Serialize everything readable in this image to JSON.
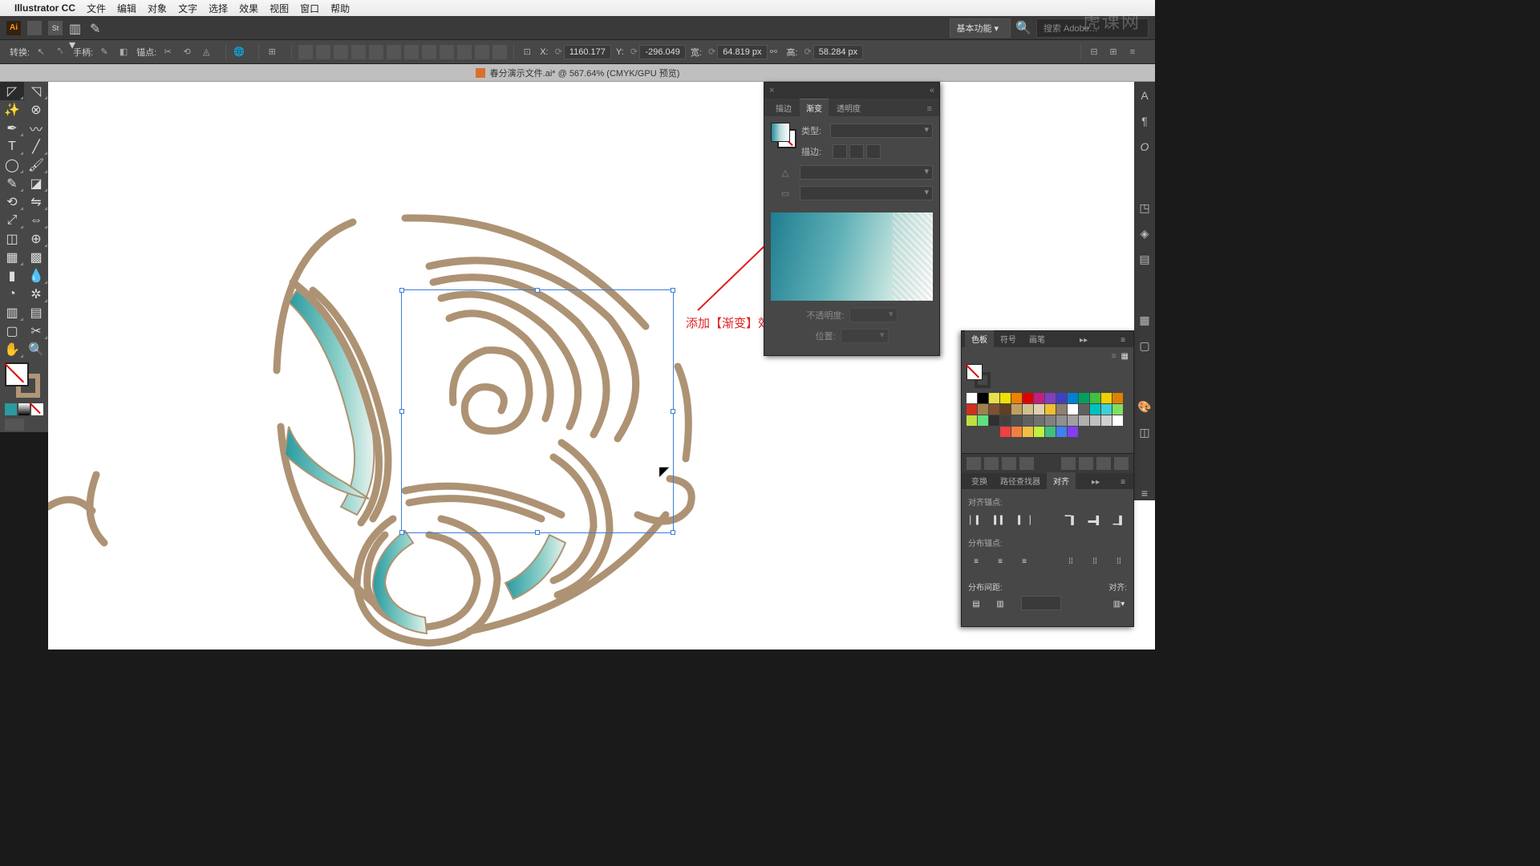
{
  "menubar": {
    "app_name": "Illustrator CC",
    "items": [
      "文件",
      "编辑",
      "对象",
      "文字",
      "选择",
      "效果",
      "视图",
      "窗口",
      "帮助"
    ]
  },
  "toolbar1": {
    "workspace": "基本功能",
    "search_placeholder": "搜索 Adobe…"
  },
  "toolbar2": {
    "transform_label": "转换:",
    "handle_label": "手柄:",
    "anchor_label": "锚点:",
    "x_label": "X:",
    "x_value": "1160.177",
    "y_label": "Y:",
    "y_value": "-296.049",
    "w_label": "宽:",
    "w_value": "64.819 px",
    "h_label": "高:",
    "h_value": "58.284 px"
  },
  "document": {
    "title": "春分演示文件.ai* @ 567.64% (CMYK/GPU 预览)"
  },
  "annot": {
    "text": "添加【渐变】效果"
  },
  "grad_panel": {
    "tab_stroke": "描边",
    "tab_gradient": "渐变",
    "tab_opacity": "透明度",
    "type_label": "类型:",
    "stroke_label": "描边:",
    "opacity_label": "不透明度:",
    "location_label": "位置:"
  },
  "swatch_panel": {
    "tab_swatches": "色板",
    "tab_symbols": "符号",
    "tab_brushes": "画笔",
    "colors_row1": [
      "#ffffff",
      "#000000",
      "#e8e04a",
      "#f0e000",
      "#f08000",
      "#e00000",
      "#c02080",
      "#8040c0",
      "#4040c0",
      "#0080d0",
      "#00a060",
      "#40c040",
      "#f0d000",
      "#e08000",
      "#d03020"
    ],
    "colors_row2": [
      "#a08050",
      "#805030",
      "#604020",
      "#c0a060",
      "#d0c090",
      "#e0d0b0",
      "#f0c030",
      "#908070",
      "#ffffff",
      "#606060",
      "#00c0c0",
      "#40d0d0",
      "#80e060",
      "#c0e040",
      "#60e080"
    ],
    "colors_row3": [
      "#303030",
      "#404040",
      "#505050",
      "#606060",
      "#707070",
      "#808080",
      "#909090",
      "#a0a0a0",
      "#b0b0b0",
      "#c0c0c0",
      "#d0d0d0",
      "#ffffff",
      "",
      "",
      ""
    ],
    "colors_row4": [
      "#f04040",
      "#f08040",
      "#f0c040",
      "#c0f040",
      "#40c080",
      "#4080f0",
      "#8040f0",
      "",
      "",
      "",
      "",
      "",
      "",
      "",
      ""
    ]
  },
  "align_panel": {
    "tab_transform": "变换",
    "tab_pathfinder": "路径查找器",
    "tab_align": "对齐",
    "align_anchors_label": "对齐锚点:",
    "distribute_anchors_label": "分布锚点:",
    "distribute_spacing_label": "分布间距:",
    "align_to_label": "对齐:"
  },
  "watermark": "虎课网"
}
